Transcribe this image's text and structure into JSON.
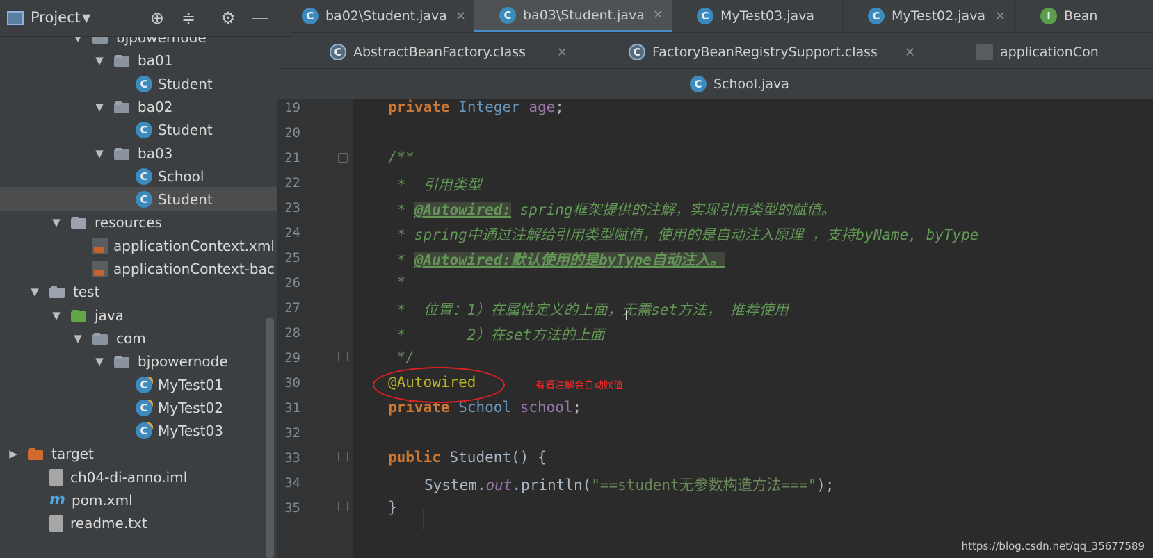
{
  "project_panel": {
    "title": "Project",
    "tree": [
      {
        "label": "bjpowernode",
        "indent": 3,
        "type": "package",
        "arrow": "▼"
      },
      {
        "label": "ba01",
        "indent": 4,
        "type": "package",
        "arrow": "▼"
      },
      {
        "label": "Student",
        "indent": 5,
        "type": "class"
      },
      {
        "label": "ba02",
        "indent": 4,
        "type": "package",
        "arrow": "▼"
      },
      {
        "label": "Student",
        "indent": 5,
        "type": "class"
      },
      {
        "label": "ba03",
        "indent": 4,
        "type": "package",
        "arrow": "▼"
      },
      {
        "label": "School",
        "indent": 5,
        "type": "class"
      },
      {
        "label": "Student",
        "indent": 5,
        "type": "class",
        "selected": true
      },
      {
        "label": "resources",
        "indent": 2,
        "type": "resources",
        "arrow": "▼"
      },
      {
        "label": "applicationContext.xml",
        "indent": 3,
        "type": "xml"
      },
      {
        "label": "applicationContext-bac",
        "indent": 3,
        "type": "xml"
      },
      {
        "label": "test",
        "indent": 1,
        "type": "folder",
        "arrow": "▼"
      },
      {
        "label": "java",
        "indent": 2,
        "type": "green-folder",
        "arrow": "▼"
      },
      {
        "label": "com",
        "indent": 3,
        "type": "package",
        "arrow": "▼"
      },
      {
        "label": "bjpowernode",
        "indent": 4,
        "type": "package",
        "arrow": "▼"
      },
      {
        "label": "MyTest01",
        "indent": 5,
        "type": "test-class"
      },
      {
        "label": "MyTest02",
        "indent": 5,
        "type": "test-class"
      },
      {
        "label": "MyTest03",
        "indent": 5,
        "type": "test-class"
      },
      {
        "label": "target",
        "indent": 0,
        "type": "orange-folder",
        "arrow": "▶"
      },
      {
        "label": "ch04-di-anno.iml",
        "indent": 1,
        "type": "file"
      },
      {
        "label": "pom.xml",
        "indent": 1,
        "type": "maven"
      },
      {
        "label": "readme.txt",
        "indent": 1,
        "type": "file"
      }
    ]
  },
  "tabs": {
    "row1": [
      {
        "label": "ba02\\Student.java",
        "icon": "C"
      },
      {
        "label": "ba03\\Student.java",
        "icon": "C",
        "active": true
      },
      {
        "label": "MyTest03.java",
        "icon": "C"
      },
      {
        "label": "MyTest02.java",
        "icon": "C"
      },
      {
        "label": "Bean",
        "icon": "I"
      }
    ],
    "row2": [
      {
        "label": "AbstractBeanFactory.class",
        "icon": "C"
      },
      {
        "label": "FactoryBeanRegistrySupport.class",
        "icon": "C"
      },
      {
        "label": "applicationCon",
        "icon": "xml"
      }
    ],
    "row3": [
      {
        "label": "School.java",
        "icon": "C"
      }
    ],
    "close_glyph": "✕"
  },
  "editor": {
    "line_numbers": [
      "19",
      "20",
      "21",
      "22",
      "23",
      "24",
      "25",
      "26",
      "27",
      "28",
      "29",
      "30",
      "31",
      "32",
      "33",
      "34",
      "35"
    ],
    "code": {
      "l19_kw": "private",
      "l19_type": "Integer",
      "l19_field": "age",
      "l21": "/**",
      "l22": " *  引用类型",
      "l23_star": " * ",
      "l23_ann": "@Autowired:",
      "l23_rest": " spring框架提供的注解，实现引用类型的赋值。",
      "l24": " * spring中通过注解给引用类型赋值，使用的是自动注入原理 ，支持byName, byType",
      "l25_star": " * ",
      "l25_ann": "@Autowired:默认使用的是byType自动注入。",
      "l26": " *",
      "l27": " *  位置：1）在属性定义的上面，无需set方法， 推荐使用",
      "l28": " *       2）在set方法的上面",
      "l29": " */",
      "l30": "@Autowired",
      "l31_kw": "private",
      "l31_type": "School",
      "l31_field": "school",
      "l33_kw": "public",
      "l33_rest": "Student() {",
      "l34_a": "System.",
      "l34_out": "out",
      "l34_b": ".println(",
      "l34_str": "\"==student无参数构造方法===\"",
      "l34_c": ");",
      "l35": "}"
    },
    "annotation_note": "有看注解会自动赋值",
    "watermark": "https://blog.csdn.net/qq_35677589"
  },
  "colors": {
    "accent": "#4a88c7",
    "circle": "#e02020",
    "note": "#ff2828"
  }
}
